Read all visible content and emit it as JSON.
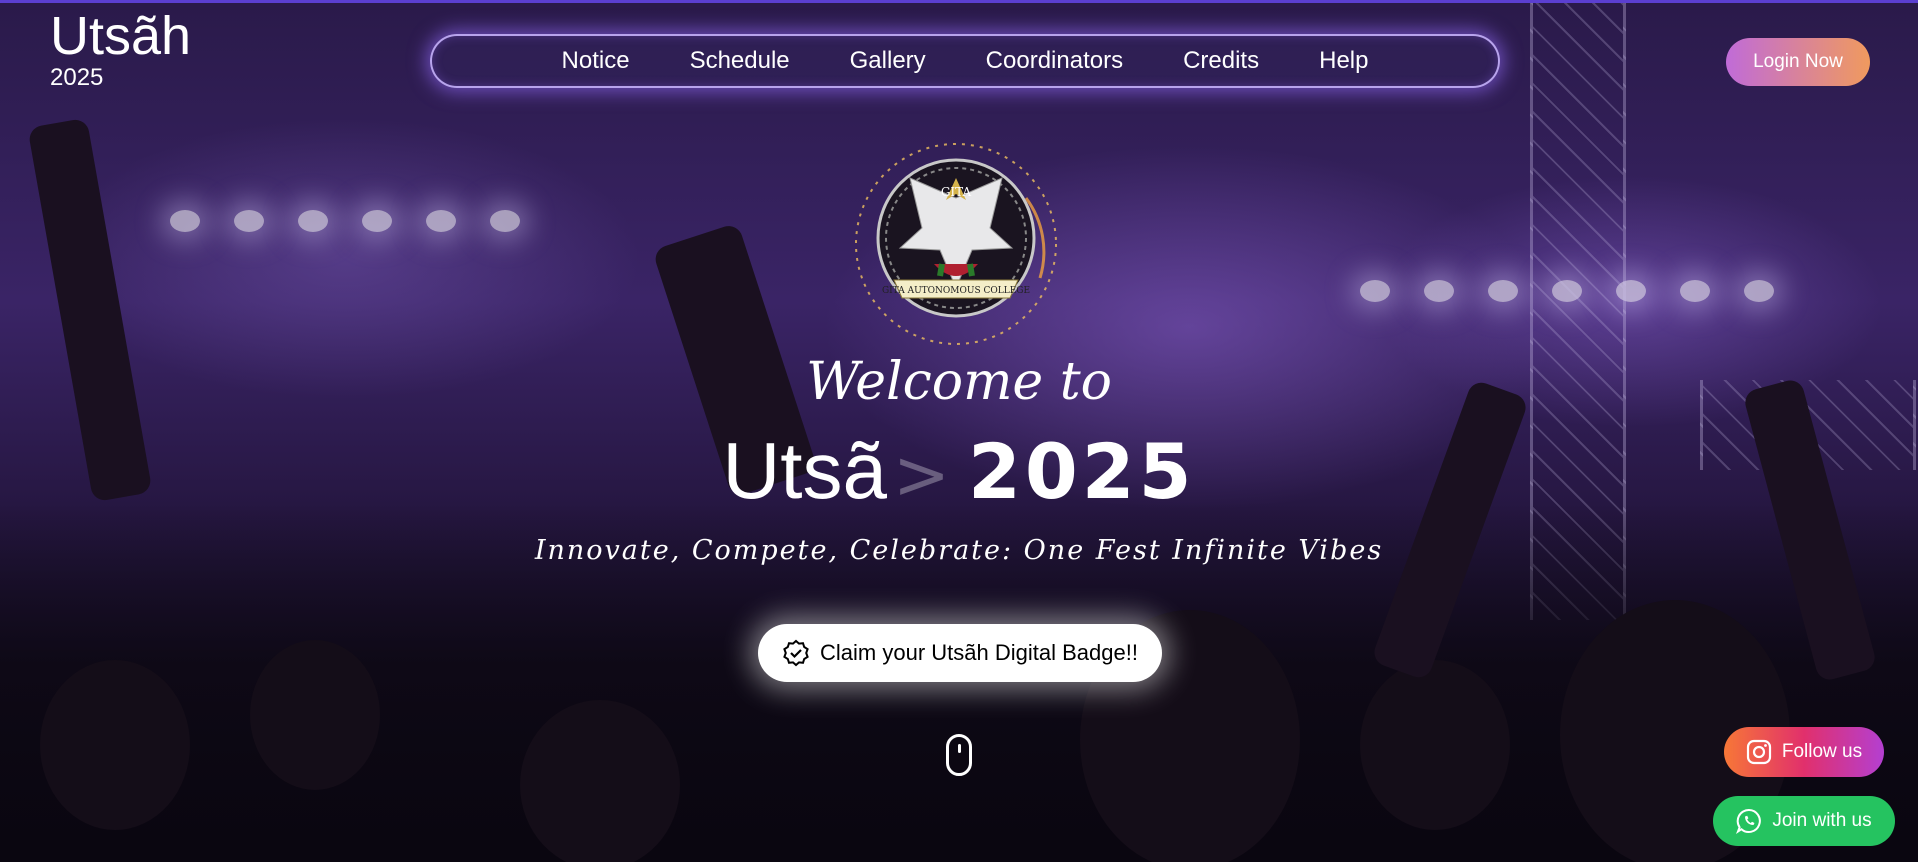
{
  "brand": {
    "name": "Utsãh",
    "year": "2025"
  },
  "nav": {
    "items": [
      {
        "label": "Notice"
      },
      {
        "label": "Schedule"
      },
      {
        "label": "Gallery"
      },
      {
        "label": "Coordinators"
      },
      {
        "label": "Credits"
      },
      {
        "label": "Help"
      }
    ]
  },
  "login_label": "Login Now",
  "emblem": {
    "icon": "college-emblem-icon",
    "text": "GITA AUTONOMOUS COLLEGE"
  },
  "hero": {
    "welcome": "Welcome to",
    "title_word": "Utsã",
    "title_caret": ">",
    "title_year": "2025",
    "tagline": "Innovate, Compete, Celebrate: One Fest Infinite Vibes"
  },
  "claim": {
    "label": "Claim your Utsãh Digital Badge!!",
    "icon": "check-circle-icon"
  },
  "scroll_icon": "mouse-scroll-icon",
  "social": {
    "follow_label": "Follow us",
    "follow_icon": "instagram-icon",
    "join_label": "Join with us",
    "join_icon": "whatsapp-icon"
  },
  "colors": {
    "accent": "#5b3fd1",
    "login_gradient": [
      "#c06bd8",
      "#f09a5e"
    ],
    "whatsapp": "#25c360"
  }
}
